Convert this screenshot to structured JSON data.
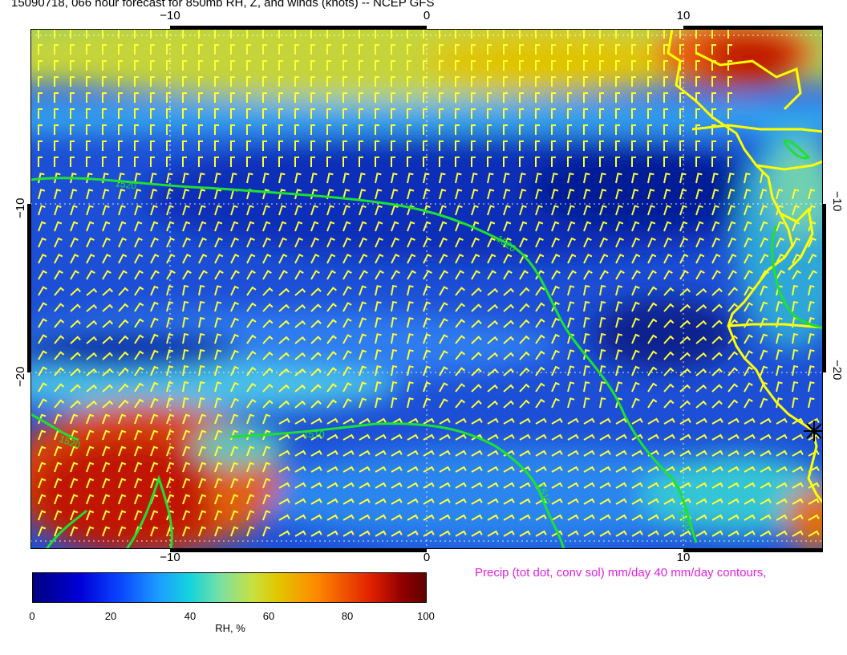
{
  "title": "15090718, 066 hour forecast for 850mb RH, Z, and winds (knots)  -- NCEP GFS",
  "axes": {
    "top_ticks": [
      "−10",
      "0",
      "10"
    ],
    "bottom_ticks": [
      "−10",
      "0",
      "10"
    ],
    "left_ticks": [
      "−10",
      "−20"
    ],
    "right_ticks": [
      "−10",
      "−20"
    ]
  },
  "contour_labels": [
    "1520",
    "1520",
    "1510",
    "1510",
    "1520",
    "1520"
  ],
  "precip_note": "Precip (tot dot, conv sol) mm/day 40 mm/day contours,",
  "colorbar": {
    "ticks": [
      "0",
      "20",
      "40",
      "60",
      "80",
      "100"
    ],
    "label": "RH, %"
  },
  "colors": {
    "coast": "#ffff00",
    "barbs": "#ffff33",
    "contours": "#00dd00",
    "precip_note": "#e020e0"
  }
}
